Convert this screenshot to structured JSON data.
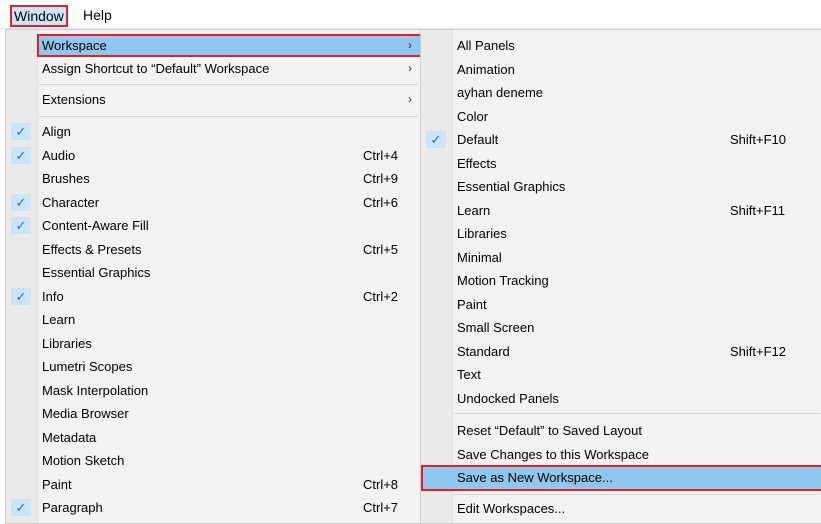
{
  "menubar": {
    "window": "Window",
    "help": "Help"
  },
  "left_menu": {
    "workspace": "Workspace",
    "assign_shortcut": "Assign Shortcut to “Default” Workspace",
    "extensions": "Extensions",
    "submenu_arrow": "›",
    "items": [
      {
        "label": "Align",
        "checked": true,
        "shortcut": ""
      },
      {
        "label": "Audio",
        "checked": true,
        "shortcut": "Ctrl+4"
      },
      {
        "label": "Brushes",
        "checked": false,
        "shortcut": "Ctrl+9"
      },
      {
        "label": "Character",
        "checked": true,
        "shortcut": "Ctrl+6"
      },
      {
        "label": "Content-Aware Fill",
        "checked": true,
        "shortcut": ""
      },
      {
        "label": "Effects & Presets",
        "checked": false,
        "shortcut": "Ctrl+5"
      },
      {
        "label": "Essential Graphics",
        "checked": false,
        "shortcut": ""
      },
      {
        "label": "Info",
        "checked": true,
        "shortcut": "Ctrl+2"
      },
      {
        "label": "Learn",
        "checked": false,
        "shortcut": ""
      },
      {
        "label": "Libraries",
        "checked": false,
        "shortcut": ""
      },
      {
        "label": "Lumetri Scopes",
        "checked": false,
        "shortcut": ""
      },
      {
        "label": "Mask Interpolation",
        "checked": false,
        "shortcut": ""
      },
      {
        "label": "Media Browser",
        "checked": false,
        "shortcut": ""
      },
      {
        "label": "Metadata",
        "checked": false,
        "shortcut": ""
      },
      {
        "label": "Motion Sketch",
        "checked": false,
        "shortcut": ""
      },
      {
        "label": "Paint",
        "checked": false,
        "shortcut": "Ctrl+8"
      },
      {
        "label": "Paragraph",
        "checked": true,
        "shortcut": "Ctrl+7"
      }
    ]
  },
  "workspace_menu": {
    "items": [
      {
        "label": "All Panels",
        "checked": false,
        "shortcut": ""
      },
      {
        "label": "Animation",
        "checked": false,
        "shortcut": ""
      },
      {
        "label": "ayhan deneme",
        "checked": false,
        "shortcut": ""
      },
      {
        "label": "Color",
        "checked": false,
        "shortcut": ""
      },
      {
        "label": "Default",
        "checked": true,
        "shortcut": "Shift+F10"
      },
      {
        "label": "Effects",
        "checked": false,
        "shortcut": ""
      },
      {
        "label": "Essential Graphics",
        "checked": false,
        "shortcut": ""
      },
      {
        "label": "Learn",
        "checked": false,
        "shortcut": "Shift+F11"
      },
      {
        "label": "Libraries",
        "checked": false,
        "shortcut": ""
      },
      {
        "label": "Minimal",
        "checked": false,
        "shortcut": ""
      },
      {
        "label": "Motion Tracking",
        "checked": false,
        "shortcut": ""
      },
      {
        "label": "Paint",
        "checked": false,
        "shortcut": ""
      },
      {
        "label": "Small Screen",
        "checked": false,
        "shortcut": ""
      },
      {
        "label": "Standard",
        "checked": false,
        "shortcut": "Shift+F12"
      },
      {
        "label": "Text",
        "checked": false,
        "shortcut": ""
      },
      {
        "label": "Undocked Panels",
        "checked": false,
        "shortcut": ""
      }
    ],
    "reset_default": "Reset “Default” to Saved Layout",
    "save_changes": "Save Changes to this Workspace",
    "save_as_new": "Save as New Workspace...",
    "edit_workspaces": "Edit Workspaces..."
  },
  "check_glyph": "✓",
  "colors": {
    "highlight": "#8fc7ef",
    "annotation_red": "#e0212b",
    "check_blue": "#1e6fc0"
  }
}
